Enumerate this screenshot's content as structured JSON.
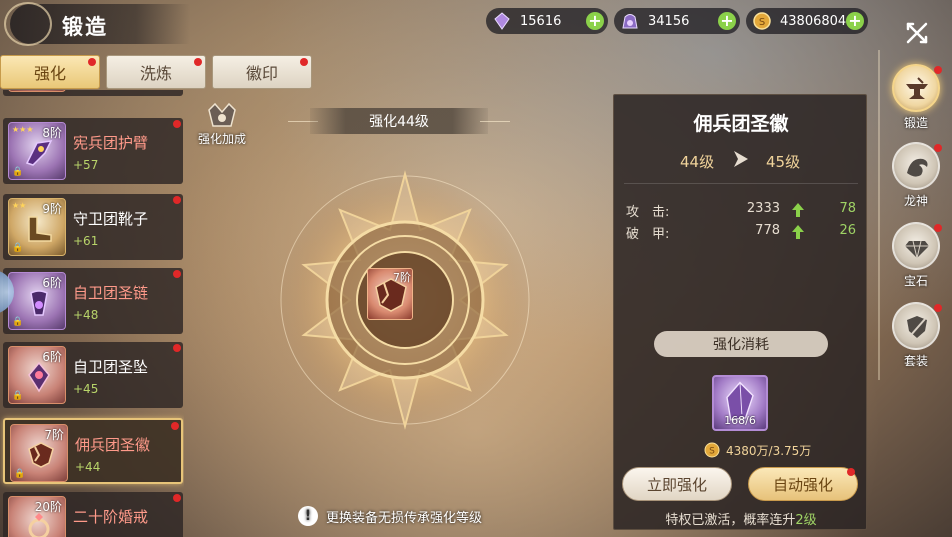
{
  "header": {
    "title": "锻造"
  },
  "tabs": [
    {
      "label": "强化",
      "active": true,
      "badge": true
    },
    {
      "label": "洗炼",
      "active": false,
      "badge": true
    },
    {
      "label": "徽印",
      "active": false,
      "badge": true
    }
  ],
  "equipment_list": [
    {
      "name": "宪兵团护臂",
      "tier": "8阶",
      "bonus": "+57",
      "icon": "armguard-icon",
      "rarity": "purple",
      "stars": "★★★",
      "name_color": "red"
    },
    {
      "name": "守卫团靴子",
      "tier": "9阶",
      "bonus": "+61",
      "icon": "boots-icon",
      "rarity": "gold",
      "stars": "★★",
      "name_color": "white"
    },
    {
      "name": "自卫团圣链",
      "tier": "6阶",
      "bonus": "+48",
      "icon": "chain-icon",
      "rarity": "red",
      "stars": "",
      "name_color": "red"
    },
    {
      "name": "自卫团圣坠",
      "tier": "6阶",
      "bonus": "+45",
      "icon": "pendant-icon",
      "rarity": "red",
      "stars": "",
      "name_color": "white"
    },
    {
      "name": "佣兵团圣徽",
      "tier": "7阶",
      "bonus": "+44",
      "icon": "emblem-icon",
      "rarity": "red",
      "stars": "",
      "name_color": "red",
      "selected": true
    },
    {
      "name": "二十阶婚戒",
      "tier": "20阶",
      "bonus": "",
      "icon": "ring-icon",
      "rarity": "red",
      "stars": "",
      "name_color": "red"
    }
  ],
  "currencies": [
    {
      "icon": "purple-crystal-icon",
      "value": "15616"
    },
    {
      "icon": "purple-gem-bag-icon",
      "value": "34156"
    },
    {
      "icon": "gold-coin-icon",
      "value": "43806804"
    }
  ],
  "center": {
    "boost_label": "强化加成",
    "level_banner": "强化44级",
    "slot_tier": "7阶",
    "notice": "更换装备无损传承强化等级"
  },
  "panel": {
    "item_name": "佣兵团圣徽",
    "level_from": "44级",
    "level_to": "45级",
    "stats": [
      {
        "label": "攻　击:",
        "value": "2333",
        "increase": "78"
      },
      {
        "label": "破　甲:",
        "value": "778",
        "increase": "26"
      }
    ],
    "cost_title": "强化消耗",
    "material_qty": "168/6",
    "coin_cost": "4380万/3.75万",
    "btn_instant": "立即强化",
    "btn_auto": "自动强化",
    "privilege_prefix": "特权已激活，概率连升",
    "privilege_value": "2级"
  },
  "right_nav": [
    {
      "label": "锻造",
      "icon": "anvil-icon",
      "active": true,
      "badge": true
    },
    {
      "label": "龙神",
      "icon": "dragon-icon",
      "active": false,
      "badge": true
    },
    {
      "label": "宝石",
      "icon": "gem-icon",
      "active": false,
      "badge": true
    },
    {
      "label": "套装",
      "icon": "sword-shield-icon",
      "active": false,
      "badge": true
    }
  ],
  "colors": {
    "accent_gold": "#e9c878",
    "badge_red": "#e02828",
    "increase_green": "#9fd365",
    "name_red": "#ff9a8a"
  }
}
